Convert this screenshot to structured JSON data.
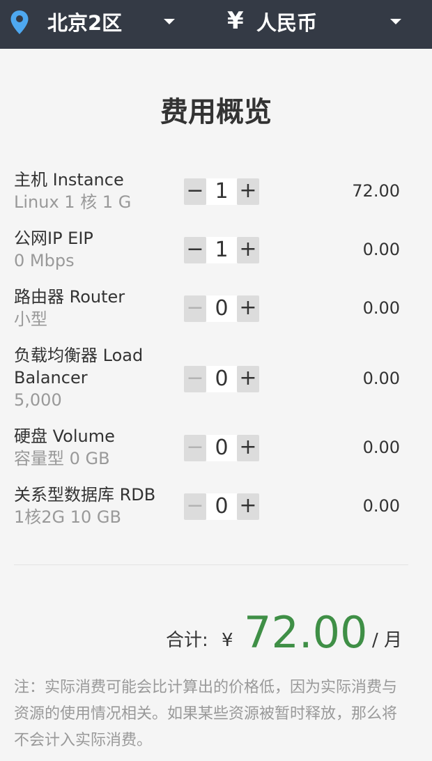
{
  "topbar": {
    "region_icon": "map-pin-icon",
    "region": "北京2区",
    "currency_symbol": "¥",
    "currency": "人民币",
    "accent_color": "#4ea8f0"
  },
  "title": "费用概览",
  "items": [
    {
      "name": "主机 Instance",
      "spec": "Linux 1 核 1 G",
      "quantity": "1",
      "minus": "−",
      "plus": "+",
      "price": "72.00",
      "minus_enabled": true
    },
    {
      "name": "公网IP EIP",
      "spec": "0 Mbps",
      "quantity": "1",
      "minus": "−",
      "plus": "+",
      "price": "0.00",
      "minus_enabled": true
    },
    {
      "name": "路由器 Router",
      "spec": "小型",
      "quantity": "0",
      "minus": "−",
      "plus": "+",
      "price": "0.00",
      "minus_enabled": false
    },
    {
      "name": "负载均衡器 Load Balancer",
      "spec": "5,000",
      "quantity": "0",
      "minus": "−",
      "plus": "+",
      "price": "0.00",
      "minus_enabled": false
    },
    {
      "name": "硬盘 Volume",
      "spec": "容量型 0 GB",
      "quantity": "0",
      "minus": "−",
      "plus": "+",
      "price": "0.00",
      "minus_enabled": false
    },
    {
      "name": "关系型数据库 RDB",
      "spec": "1核2G 10 GB",
      "quantity": "0",
      "minus": "−",
      "plus": "+",
      "price": "0.00",
      "minus_enabled": false
    }
  ],
  "total": {
    "label": "合计:",
    "currency": "¥",
    "value": "72.00",
    "unit": "/ 月",
    "color": "#3f8f46"
  },
  "note": "注：实际消费可能会比计算出的价格低，因为实际消费与资源的使用情况相关。如果某些资源被暂时释放，那么将不会计入实际消费。"
}
